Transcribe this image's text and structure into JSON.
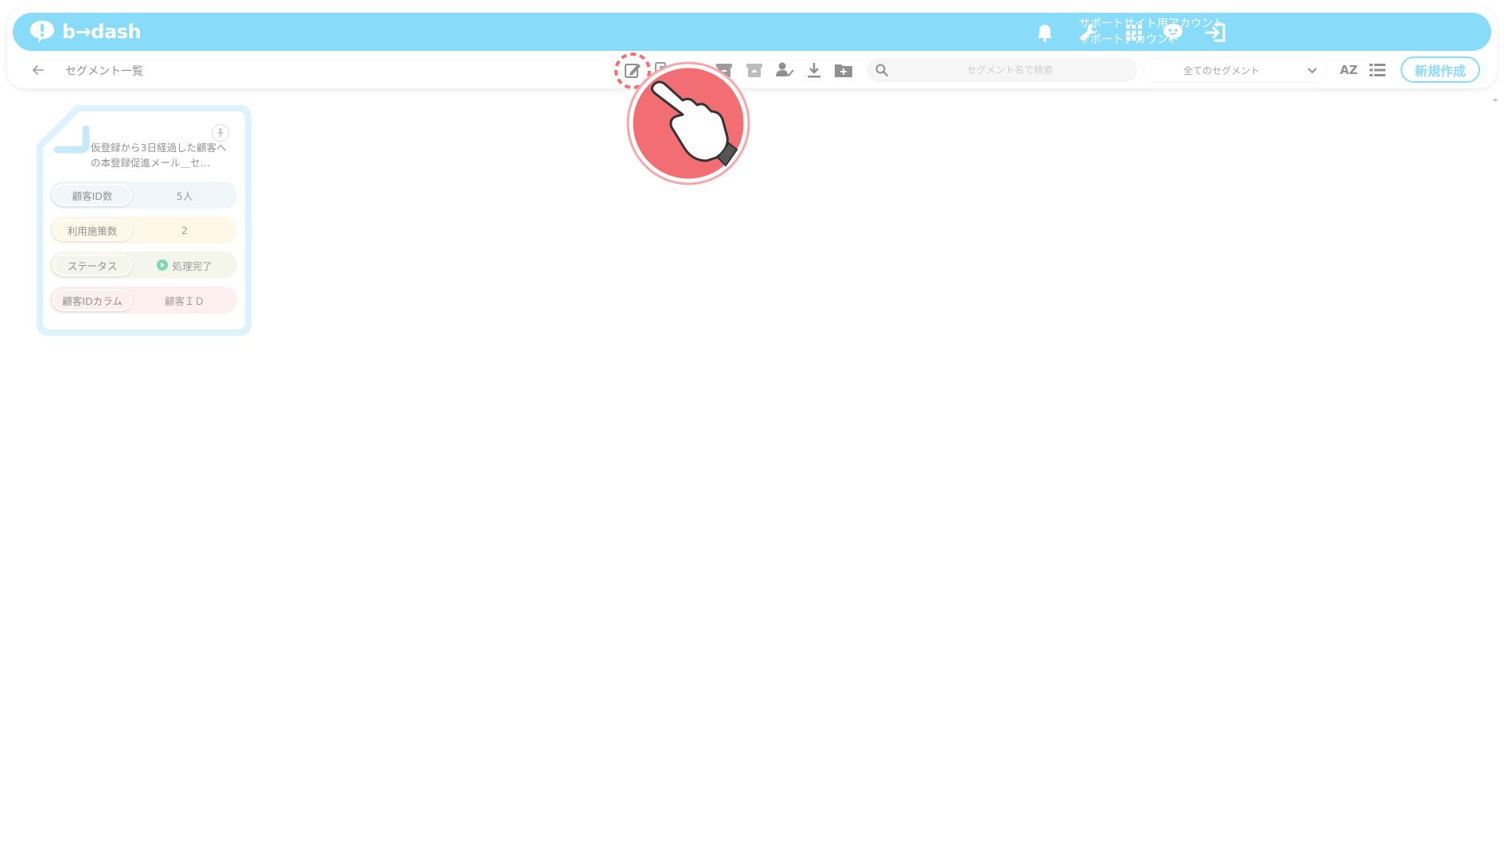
{
  "header": {
    "logo_text": "b→dash",
    "account_line1": "サポートサイト用アカウント",
    "account_line2": "サポートアカウント",
    "icons": [
      "bell-icon",
      "wrench-icon",
      "apps-grid-icon",
      "chat-bot-icon",
      "logout-icon"
    ],
    "color": "#4ac8f7"
  },
  "toolbar": {
    "page_title": "セグメント一覧",
    "icons": [
      "edit-icon",
      "copy-icon",
      "delete-icon",
      "archive-icon",
      "unarchive-icon",
      "user-check-icon",
      "download-icon",
      "folder-add-icon"
    ],
    "search_placeholder": "セグメント名で検索",
    "filter_selected": "全てのセグメント",
    "sort_label": "AZ",
    "new_button": "新規作成"
  },
  "card": {
    "title": "仮登録から3日経過した顧客への本登録促進メール＿セ…",
    "rows": [
      {
        "label": "顧客ID数",
        "value": "5人",
        "color": "#e8f1f8"
      },
      {
        "label": "利用施策数",
        "value": "2",
        "color": "#fff4dc"
      },
      {
        "label": "ステータス",
        "value": "処理完了",
        "color": "#eef2e2"
      },
      {
        "label": "顧客IDカラム",
        "value": "顧客ＩＤ",
        "color": "#fde6e6"
      }
    ],
    "border_color": "#a8ddf5",
    "status_color": "#3cc08a"
  },
  "hint": {
    "color": "#f26e73"
  }
}
